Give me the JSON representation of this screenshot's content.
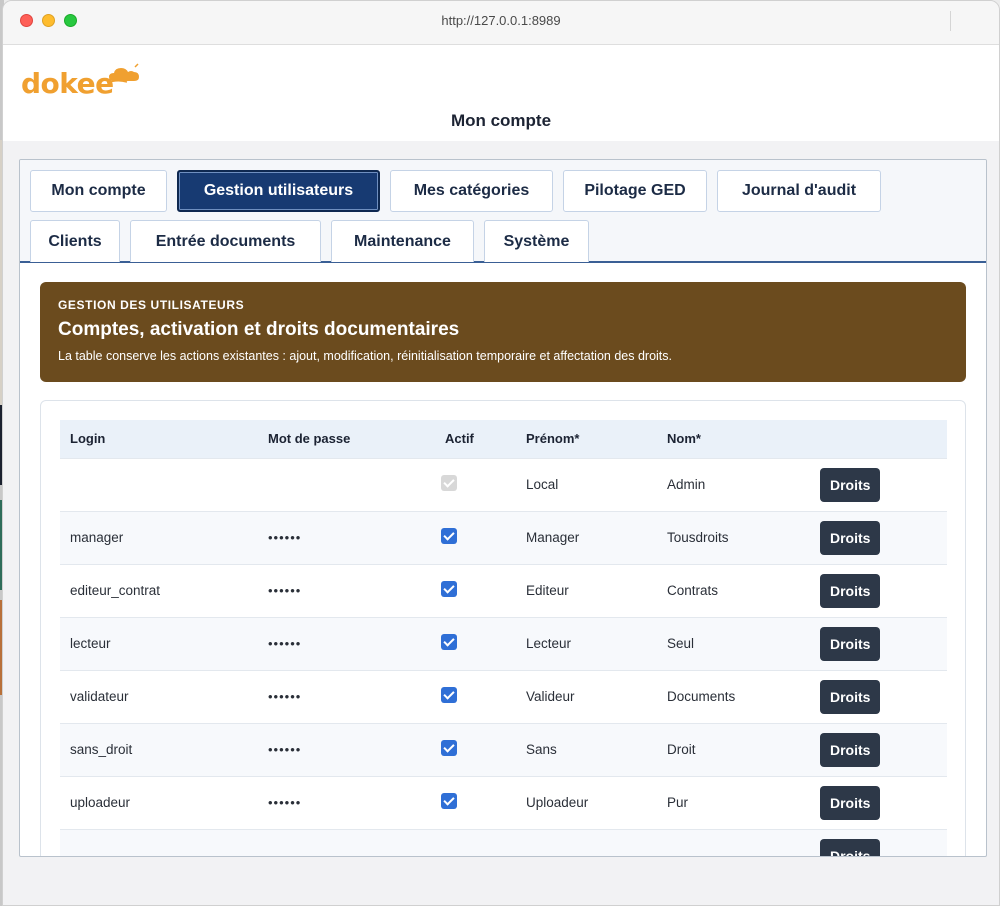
{
  "browser": {
    "url": "http://127.0.0.1:8989"
  },
  "header": {
    "logo_text": "dokee",
    "page_title": "Mon compte"
  },
  "tabs": [
    {
      "label": "Mon compte",
      "active": false
    },
    {
      "label": "Gestion utilisateurs",
      "active": true
    },
    {
      "label": "Mes catégories",
      "active": false
    },
    {
      "label": "Pilotage GED",
      "active": false
    },
    {
      "label": "Journal d'audit",
      "active": false
    },
    {
      "label": "Clients",
      "active": false
    },
    {
      "label": "Entrée documents",
      "active": false
    },
    {
      "label": "Maintenance",
      "active": false
    },
    {
      "label": "Système",
      "active": false
    }
  ],
  "banner": {
    "kicker": "GESTION DES UTILISATEURS",
    "title": "Comptes, activation et droits documentaires",
    "description": "La table conserve les actions existantes : ajout, modification, réinitialisation temporaire et affectation des droits."
  },
  "table": {
    "columns": [
      "Login",
      "Mot de passe",
      "Actif",
      "Prénom*",
      "Nom*",
      ""
    ],
    "button_label": "Droits",
    "rows": [
      {
        "login": "",
        "password": "",
        "active": true,
        "active_disabled": true,
        "prenom": "Local",
        "nom": "Admin"
      },
      {
        "login": "manager",
        "password": "••••••",
        "active": true,
        "active_disabled": false,
        "prenom": "Manager",
        "nom": "Tousdroits"
      },
      {
        "login": "editeur_contrat",
        "password": "••••••",
        "active": true,
        "active_disabled": false,
        "prenom": "Editeur",
        "nom": "Contrats"
      },
      {
        "login": "lecteur",
        "password": "••••••",
        "active": true,
        "active_disabled": false,
        "prenom": "Lecteur",
        "nom": "Seul"
      },
      {
        "login": "validateur",
        "password": "••••••",
        "active": true,
        "active_disabled": false,
        "prenom": "Valideur",
        "nom": "Documents"
      },
      {
        "login": "sans_droit",
        "password": "••••••",
        "active": true,
        "active_disabled": false,
        "prenom": "Sans",
        "nom": "Droit"
      },
      {
        "login": "uploadeur",
        "password": "••••••",
        "active": true,
        "active_disabled": false,
        "prenom": "Uploadeur",
        "nom": "Pur"
      },
      {
        "login": "",
        "password": "",
        "active": false,
        "active_disabled": false,
        "prenom": "",
        "nom": ""
      }
    ]
  }
}
